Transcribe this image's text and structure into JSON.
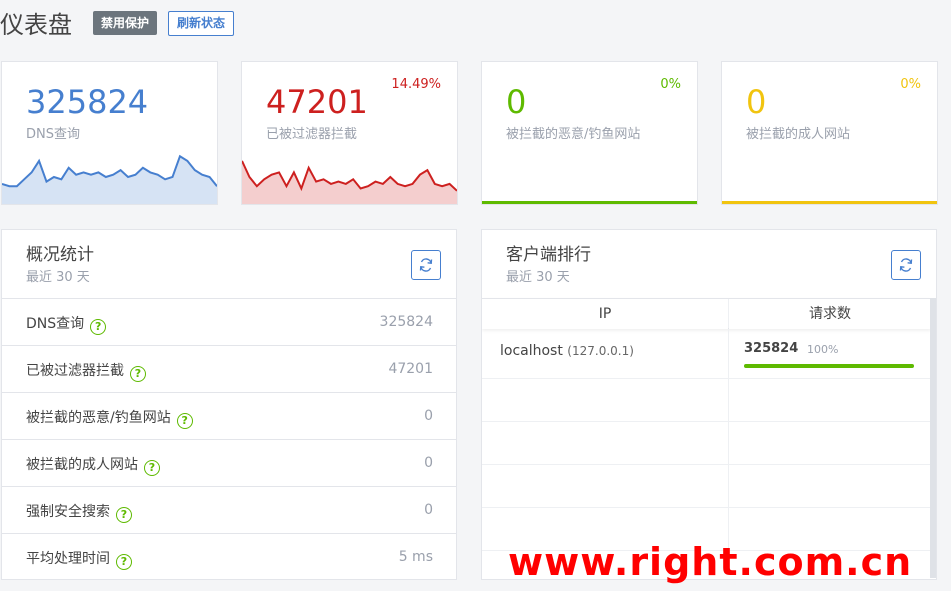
{
  "header": {
    "title": "仪表盘",
    "disable_protection": "禁用保护",
    "refresh_status": "刷新状态"
  },
  "stats": [
    {
      "value": "325824",
      "label": "DNS查询",
      "pct": "",
      "color": "#467fcf",
      "spark": [
        0.35,
        0.3,
        0.3,
        0.45,
        0.6,
        0.85,
        0.4,
        0.5,
        0.45,
        0.7,
        0.55,
        0.6,
        0.55,
        0.6,
        0.5,
        0.55,
        0.65,
        0.5,
        0.55,
        0.7,
        0.6,
        0.55,
        0.45,
        0.5,
        0.95,
        0.85,
        0.65,
        0.55,
        0.5,
        0.3
      ]
    },
    {
      "value": "47201",
      "label": "已被过滤器拦截",
      "pct": "14.49%",
      "color": "#cd201f",
      "spark": [
        0.85,
        0.5,
        0.3,
        0.45,
        0.55,
        0.6,
        0.3,
        0.6,
        0.25,
        0.7,
        0.4,
        0.45,
        0.35,
        0.4,
        0.35,
        0.45,
        0.25,
        0.3,
        0.4,
        0.35,
        0.5,
        0.35,
        0.3,
        0.35,
        0.55,
        0.65,
        0.35,
        0.3,
        0.35,
        0.2
      ]
    },
    {
      "value": "0",
      "label": "被拦截的恶意/钓鱼网站",
      "pct": "0%",
      "color": "#5eba00",
      "spark": []
    },
    {
      "value": "0",
      "label": "被拦截的成人网站",
      "pct": "0%",
      "color": "#f1c40f",
      "spark": []
    }
  ],
  "overview": {
    "title": "概况统计",
    "subtitle": "最近 30 天",
    "rows": [
      {
        "label": "DNS查询",
        "value": "325824"
      },
      {
        "label": "已被过滤器拦截",
        "value": "47201"
      },
      {
        "label": "被拦截的恶意/钓鱼网站",
        "value": "0"
      },
      {
        "label": "被拦截的成人网站",
        "value": "0"
      },
      {
        "label": "强制安全搜索",
        "value": "0"
      },
      {
        "label": "平均处理时间",
        "value": "5 ms"
      }
    ]
  },
  "clients": {
    "title": "客户端排行",
    "subtitle": "最近 30 天",
    "col_ip": "IP",
    "col_requests": "请求数",
    "rows": [
      {
        "name": "localhost",
        "ip": "(127.0.0.1)",
        "requests": "325824",
        "pct": "100%",
        "fill": 1.0
      }
    ]
  },
  "watermark": "www.right.com.cn"
}
